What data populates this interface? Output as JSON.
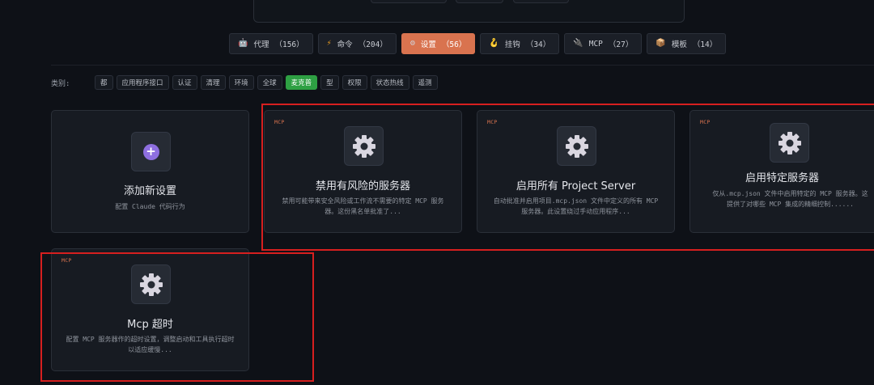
{
  "tabs": [
    {
      "icon": "🤖",
      "label": "代理",
      "count": "（156）",
      "active": false
    },
    {
      "icon": "⚡",
      "label": "命令",
      "count": "（204）",
      "active": false
    },
    {
      "icon": "⚙",
      "label": "设置",
      "count": "（56）",
      "active": true
    },
    {
      "icon": "🪝",
      "label": "挂钩",
      "count": "（34）",
      "active": false
    },
    {
      "icon": "🔌",
      "label": "MCP",
      "count": "（27）",
      "active": false
    },
    {
      "icon": "📦",
      "label": "模板",
      "count": "（14）",
      "active": false
    }
  ],
  "categories": {
    "label": "类别:",
    "items": [
      "都",
      "应用程序接口",
      "认证",
      "清理",
      "环境",
      "全球",
      "麦克普",
      "型",
      "权限",
      "状态热线",
      "遥测"
    ],
    "active": "麦克普"
  },
  "cards": {
    "add": {
      "title": "添加新设置",
      "desc": "配置 Claude 代码行为"
    },
    "disable_risky": {
      "tag": "MCP",
      "title": "禁用有风险的服务器",
      "desc": "禁用可能带来安全风险或工作流不需要的特定 MCP 服务器。这份黑名单批准了..."
    },
    "enable_all": {
      "tag": "MCP",
      "title": "启用所有 Project Server",
      "desc": "自动批准并启用项目.mcp.json 文件中定义的所有 MCP 服务器。此设置绕过手动应用程序..."
    },
    "enable_specific": {
      "tag": "MCP",
      "title": "启用特定服务器",
      "desc": "仅从.mcp.json 文件中启用特定的 MCP 服务器。这提供了对哪些 MCP 集成的精细控制......"
    },
    "timeout": {
      "tag": "MCP",
      "title": "Mcp 超时",
      "desc": "配置 MCP 服务器作的超时设置，调整启动和工具执行超时以适应缓慢..."
    }
  },
  "colors": {
    "accent": "#d9734f",
    "active_chip": "#2ea043",
    "highlight": "#d61f1f",
    "plus": "#8e6fe0"
  }
}
